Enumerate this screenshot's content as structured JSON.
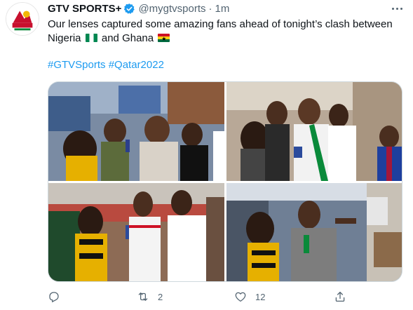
{
  "tweet": {
    "author": {
      "name": "GTV SPORTS+",
      "handle": "@mygtvsports",
      "verified": true,
      "avatar_icon": "gtv-sports-logo"
    },
    "separator": "·",
    "time": "1m",
    "text_line1": "Our lenses captured some amazing fans ahead of tonight’s clash between",
    "text_line2_a": "Nigeria",
    "text_line2_b": "and Ghana",
    "flags": [
      "nigeria-flag",
      "ghana-flag"
    ],
    "hashtags": [
      "#GTVSports",
      "#Qatar2022"
    ],
    "photos": [
      "fans-interview-street",
      "fans-group-smiling",
      "fan-ghana-jersey-interview",
      "fan-interview-market"
    ],
    "actions": {
      "reply_count": "",
      "retweet_count": "2",
      "like_count": "12"
    },
    "colors": {
      "accent": "#1d9bf0",
      "text": "#0f1419",
      "secondary": "#536471",
      "border": "#cfd9de"
    }
  }
}
